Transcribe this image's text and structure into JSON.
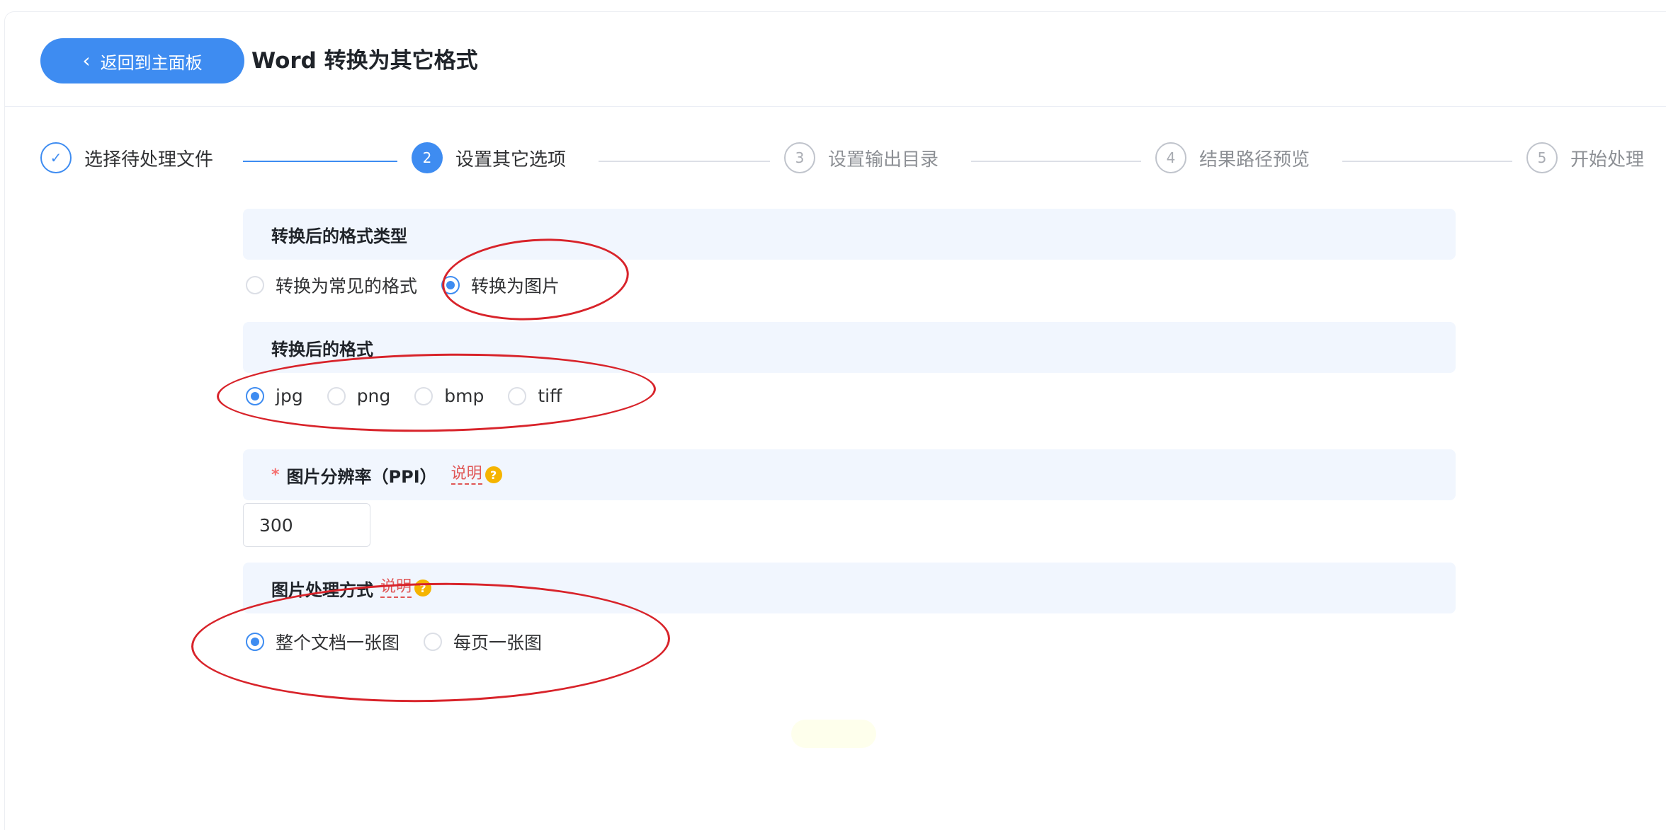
{
  "header": {
    "back_label": "返回到主面板",
    "title": "Word 转换为其它格式"
  },
  "steps": [
    {
      "index": "✓",
      "label": "选择待处理文件",
      "state": "done"
    },
    {
      "index": "2",
      "label": "设置其它选项",
      "state": "active"
    },
    {
      "index": "3",
      "label": "设置输出目录",
      "state": "pending"
    },
    {
      "index": "4",
      "label": "结果路径预览",
      "state": "pending"
    },
    {
      "index": "5",
      "label": "开始处理",
      "state": "pending"
    }
  ],
  "sections": {
    "format_type": {
      "title": "转换后的格式类型",
      "options": [
        "转换为常见的格式",
        "转换为图片"
      ],
      "selected": "转换为图片"
    },
    "format": {
      "title": "转换后的格式",
      "options": [
        "jpg",
        "png",
        "bmp",
        "tiff"
      ],
      "selected": "jpg"
    },
    "resolution": {
      "required_mark": "*",
      "title": "图片分辨率（PPI）",
      "hint": "说明",
      "value": "300"
    },
    "mode": {
      "title": "图片处理方式",
      "hint": "说明",
      "options": [
        "整个文档一张图",
        "每页一张图"
      ],
      "selected": "整个文档一张图"
    }
  },
  "colors": {
    "accent": "#3e8cf1",
    "section_bg": "#f1f6fe",
    "annotation_red": "#d8232a"
  }
}
